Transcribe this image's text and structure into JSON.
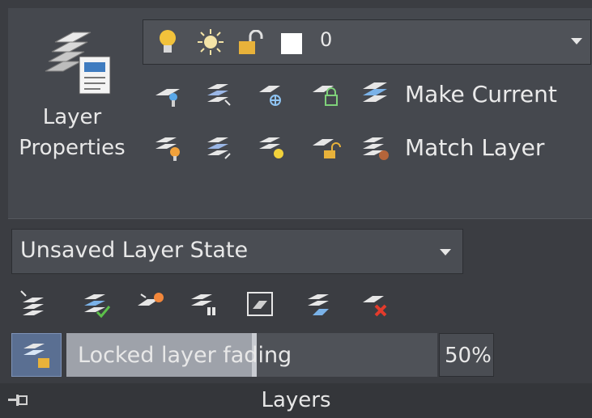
{
  "panel": {
    "title": "Layers"
  },
  "layer_properties": {
    "label_line1": "Layer",
    "label_line2": "Properties"
  },
  "layer_control": {
    "current_layer": "0",
    "color": "#ffffff"
  },
  "tools": {
    "make_current": "Make Current",
    "match_layer": "Match Layer"
  },
  "layer_state": {
    "value": "Unsaved Layer State"
  },
  "fade": {
    "label": "Locked layer fading",
    "percent": "50%",
    "value": 0.5
  },
  "colors": {
    "accent": "#5a6f92",
    "bulb": "#f2c23b",
    "check": "#5cc04a",
    "delete": "#e33b2c"
  }
}
